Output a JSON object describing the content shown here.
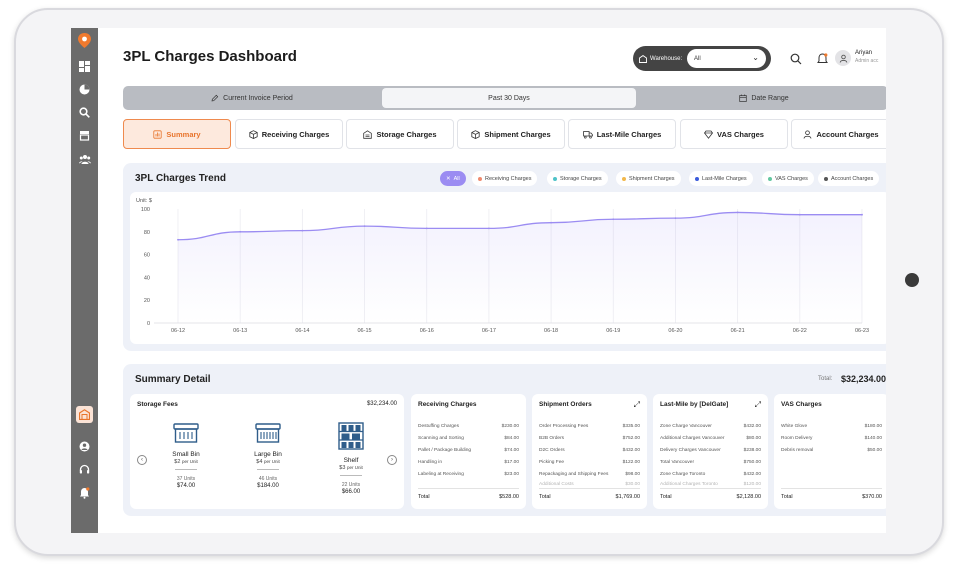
{
  "header": {
    "title": "3PL Charges Dashboard",
    "warehouse_label": "Warehouse:",
    "warehouse_value": "All",
    "user_name": "Ariyan",
    "user_role": "Admin acc"
  },
  "period_tabs": [
    {
      "label": "Current Invoice Period"
    },
    {
      "label": "Past 30 Days"
    },
    {
      "label": "Date Range"
    }
  ],
  "category_tabs": [
    {
      "label": "Summary"
    },
    {
      "label": "Receiving Charges"
    },
    {
      "label": "Storage Charges"
    },
    {
      "label": "Shipment Charges"
    },
    {
      "label": "Last-Mile Charges"
    },
    {
      "label": "VAS Charges"
    },
    {
      "label": "Account Charges"
    }
  ],
  "trend": {
    "title": "3PL Charges Trend",
    "chips": [
      {
        "label": "All",
        "color": "#ffffff"
      },
      {
        "label": "Receiving Charges",
        "color": "#ef8a6e"
      },
      {
        "label": "Storage Charges",
        "color": "#4fc3c8"
      },
      {
        "label": "Shipment Charges",
        "color": "#f2b84b"
      },
      {
        "label": "Last-Mile Charges",
        "color": "#3b5bdb"
      },
      {
        "label": "VAS Charges",
        "color": "#63c7a0"
      },
      {
        "label": "Account Charges",
        "color": "#555555"
      }
    ]
  },
  "chart_data": {
    "type": "area",
    "ylabel": "Unit: $",
    "ylim": [
      0,
      100
    ],
    "yticks": [
      0,
      20,
      40,
      60,
      80,
      100
    ],
    "categories": [
      "06-12",
      "06-13",
      "06-14",
      "06-15",
      "06-16",
      "06-17",
      "06-18",
      "06-19",
      "06-20",
      "06-21",
      "06-22",
      "06-23"
    ],
    "series": [
      {
        "values": [
          73,
          80,
          81,
          85,
          83,
          83,
          88,
          91,
          92,
          97,
          95,
          95
        ],
        "color": "#9b8cf2"
      }
    ],
    "grid": "vertical"
  },
  "summary": {
    "title": "Summary Detail",
    "total_label": "Total:",
    "total_value": "$32,234.00",
    "storage": {
      "title": "Storage Fees",
      "amount": "$32,234.00",
      "bins": [
        {
          "name": "Small Bin",
          "price": "$2",
          "per": "per Unit",
          "units": "37 Units",
          "total": "$74.00"
        },
        {
          "name": "Large Bin",
          "price": "$4",
          "per": "per Unit",
          "units": "46 Units",
          "total": "$184.00"
        },
        {
          "name": "Shelf",
          "price": "$3",
          "per": "per Unit",
          "units": "22 Units",
          "total": "$66.00"
        }
      ]
    },
    "cards": [
      {
        "title": "Receiving Charges",
        "rows": [
          {
            "label": "Destuffing Charges",
            "value": "$230.00"
          },
          {
            "label": "Scanning and Sorting",
            "value": "$84.00"
          },
          {
            "label": "Pallet / Package Building",
            "value": "$74.00"
          },
          {
            "label": "Handling in",
            "value": "$17.00"
          },
          {
            "label": "Labeling at Receiving",
            "value": "$23.00"
          }
        ],
        "total_label": "Total",
        "total_value": "$528.00"
      },
      {
        "title": "Shipment Orders",
        "rows": [
          {
            "label": "Order Processing Fees",
            "value": "$335.00"
          },
          {
            "label": "B2B Orders",
            "value": "$752.00"
          },
          {
            "label": "D2C Orders",
            "value": "$432.00"
          },
          {
            "label": "Picking Fee",
            "value": "$122.00"
          },
          {
            "label": "Repackaging and Shipping Fees",
            "value": "$98.00"
          },
          {
            "label": "Additional Costs",
            "value": "$30.00"
          }
        ],
        "total_label": "Total",
        "total_value": "$1,769.00"
      },
      {
        "title": "Last-Mile by [DelGate]",
        "rows": [
          {
            "label": "Zone Charge Vancouver",
            "value": "$432.00"
          },
          {
            "label": "Additional Charges Vancouver",
            "value": "$80.00"
          },
          {
            "label": "Delivery Charges Vancouver",
            "value": "$238.00"
          },
          {
            "label": "Total Vancouver",
            "value": "$750.00"
          },
          {
            "label": "Zone Charge Toronto",
            "value": "$432.00"
          },
          {
            "label": "Additional Charges Toronto",
            "value": "$120.00"
          }
        ],
        "total_label": "Total",
        "total_value": "$2,128.00"
      },
      {
        "title": "VAS Charges",
        "rows": [
          {
            "label": "White Glove",
            "value": "$180.00"
          },
          {
            "label": "Room Delivery",
            "value": "$140.00"
          },
          {
            "label": "Debris removal",
            "value": "$50.00"
          }
        ],
        "total_label": "Total",
        "total_value": "$370.00"
      }
    ]
  }
}
